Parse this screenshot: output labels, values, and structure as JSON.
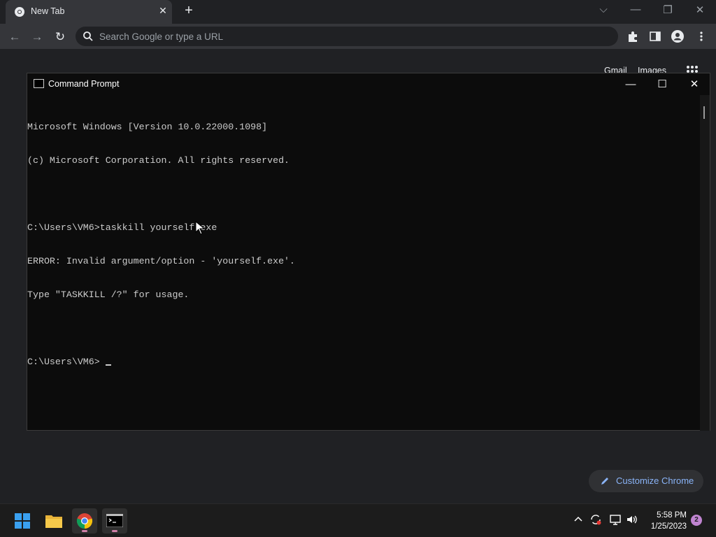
{
  "browser": {
    "tab": {
      "title": "New Tab",
      "close_glyph": "✕"
    },
    "new_tab_glyph": "+",
    "window_controls": {
      "dropdown": "⌵",
      "minimize": "—",
      "restore": "❐",
      "close": "✕"
    },
    "nav": {
      "back": "←",
      "forward": "→",
      "reload": "↻"
    },
    "omnibox": {
      "placeholder": "Search Google or type a URL"
    },
    "ntp": {
      "links": [
        "Gmail",
        "Images"
      ],
      "customize_label": "Customize Chrome"
    }
  },
  "cmd": {
    "title": "Command Prompt",
    "controls": {
      "minimize": "—",
      "maximize": "☐",
      "close": "✕"
    },
    "lines": [
      "Microsoft Windows [Version 10.0.22000.1098]",
      "(c) Microsoft Corporation. All rights reserved.",
      "",
      "C:\\Users\\VM6>taskkill yourself.exe",
      "ERROR: Invalid argument/option - 'yourself.exe'.",
      "Type \"TASKKILL /?\" for usage.",
      ""
    ],
    "prompt_line": "C:\\Users\\VM6> "
  },
  "taskbar": {
    "clock": {
      "time": "5:58 PM",
      "date": "1/25/2023"
    },
    "notification_count": "2",
    "tray_icons": [
      "chevron-up-icon",
      "sync-icon",
      "network-icon",
      "volume-icon"
    ]
  },
  "colors": {
    "accent": "#8ab4f8",
    "console_bg": "#0c0c0c",
    "console_text": "#cccccc",
    "taskbar_indicator": "#d080a8"
  }
}
